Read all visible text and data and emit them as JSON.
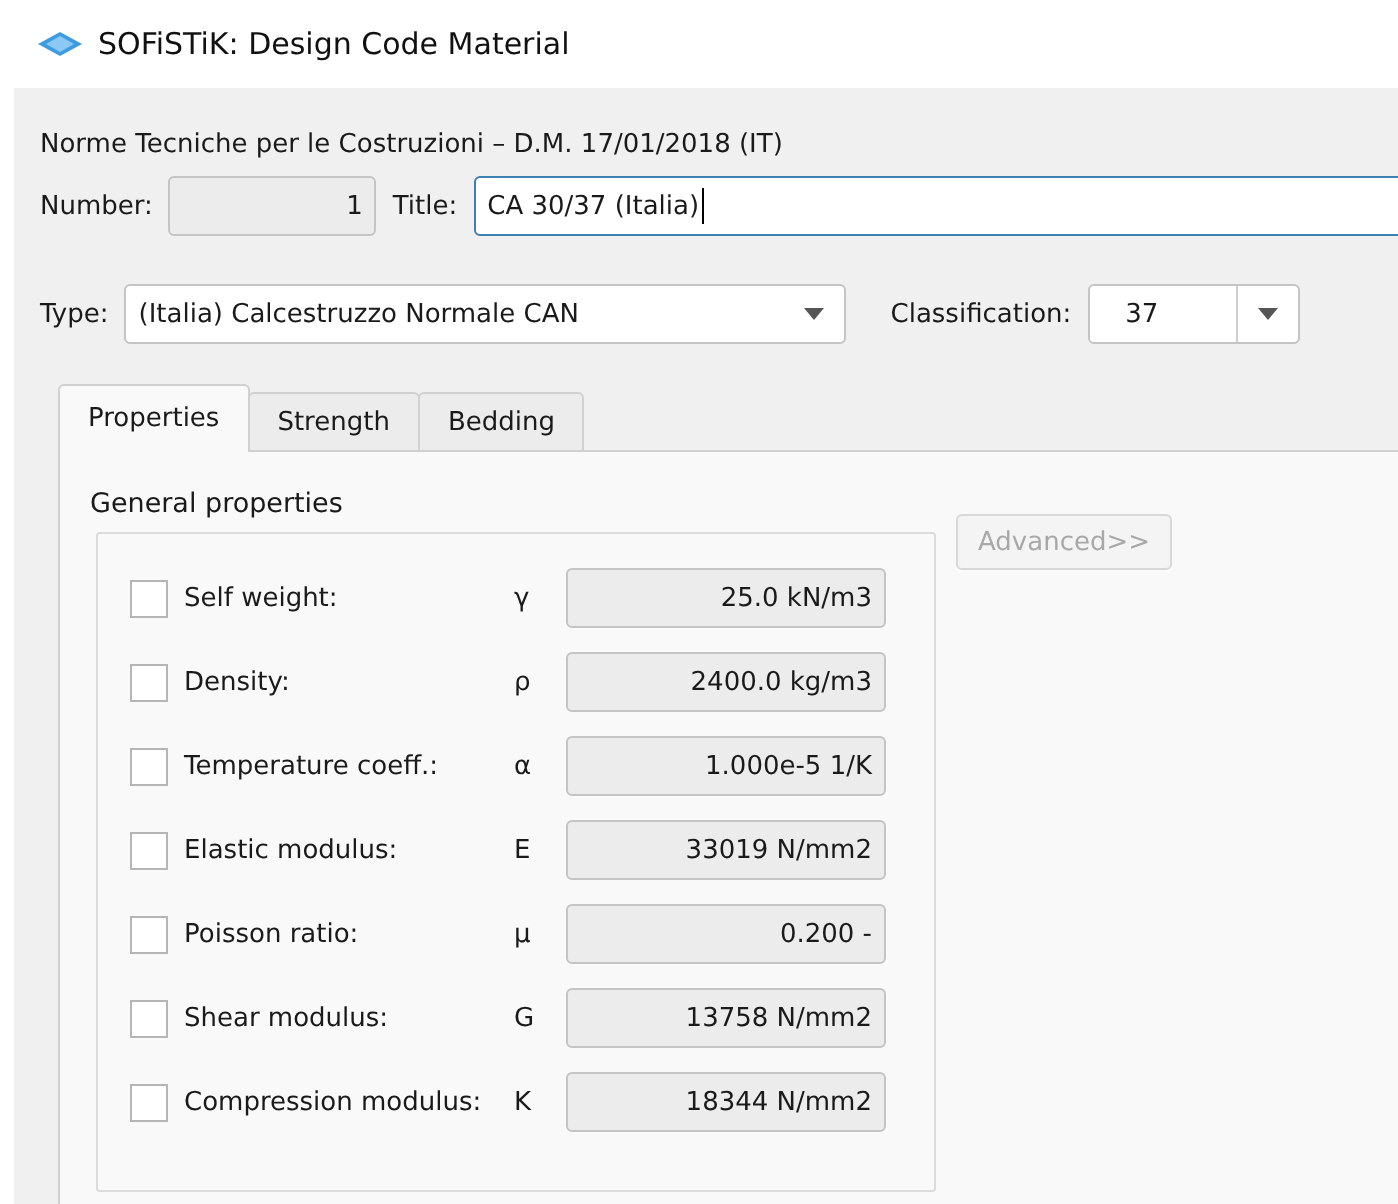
{
  "window": {
    "title": "SOFiSTiK: Design Code Material"
  },
  "code_label": "Norme Tecniche per le Costruzioni – D.M. 17/01/2018 (IT)",
  "number": {
    "label": "Number:",
    "value": "1"
  },
  "title_field": {
    "label": "Title:",
    "value": "CA 30/37 (Italia)"
  },
  "type": {
    "label": "Type:",
    "value": "(Italia) Calcestruzzo Normale CAN"
  },
  "classification": {
    "label": "Classification:",
    "value": "37"
  },
  "tabs": [
    {
      "label": "Properties",
      "selected": true
    },
    {
      "label": "Strength",
      "selected": false
    },
    {
      "label": "Bedding",
      "selected": false
    }
  ],
  "group_title": "General properties",
  "advanced_button": {
    "label": "Advanced>>",
    "disabled": true
  },
  "properties": [
    {
      "label": "Self weight:",
      "symbol": "γ",
      "value": "25.0 kN/m3",
      "checked": false
    },
    {
      "label": "Density:",
      "symbol": "ρ",
      "value": "2400.0 kg/m3",
      "checked": false
    },
    {
      "label": "Temperature coeff.:",
      "symbol": "α",
      "value": "1.000e-5 1/K",
      "checked": false
    },
    {
      "label": "Elastic modulus:",
      "symbol": "E",
      "value": "33019 N/mm2",
      "checked": false
    },
    {
      "label": "Poisson ratio:",
      "symbol": "μ",
      "value": "0.200 -",
      "checked": false
    },
    {
      "label": "Shear modulus:",
      "symbol": "G",
      "value": "13758 N/mm2",
      "checked": false
    },
    {
      "label": "Compression modulus:",
      "symbol": "K",
      "value": "18344 N/mm2",
      "checked": false
    }
  ]
}
